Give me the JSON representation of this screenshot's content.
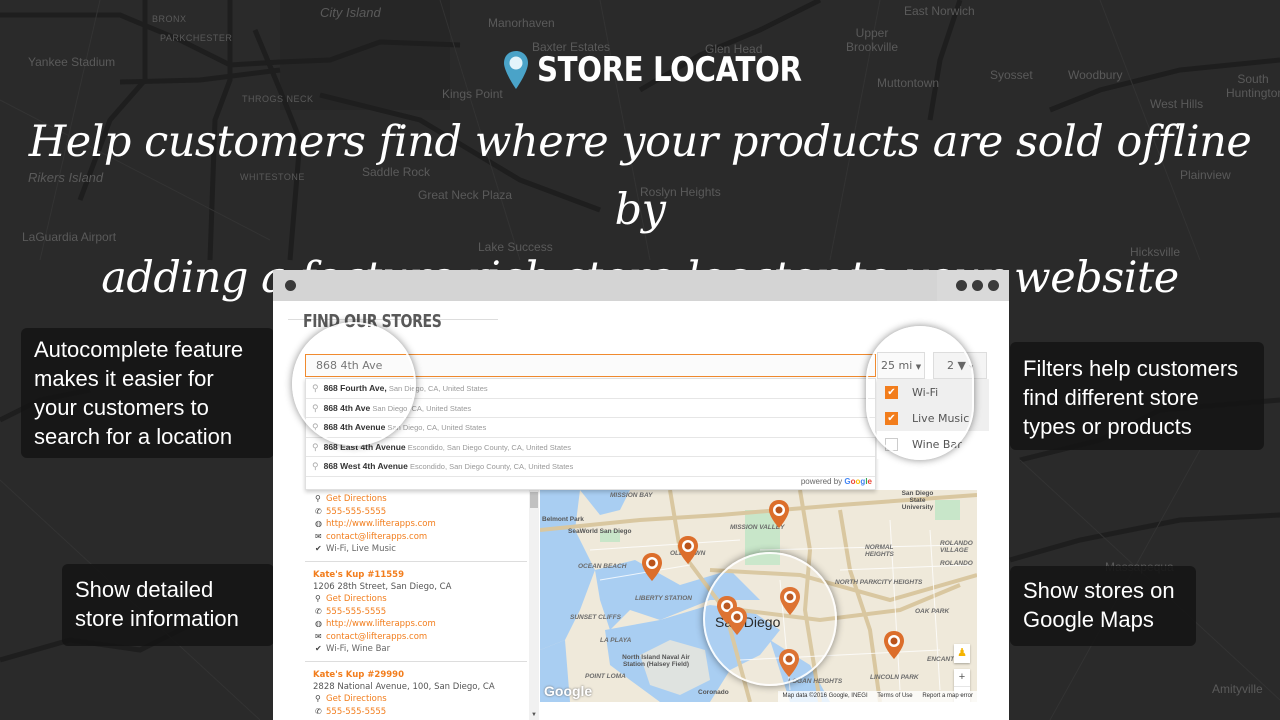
{
  "background_map": {
    "labels": [
      {
        "text": "City Island",
        "style": "it"
      },
      {
        "text": "Yankee Stadium",
        "style": ""
      },
      {
        "text": "Rikers Island",
        "style": "it"
      },
      {
        "text": "LaGuardia Airport",
        "style": ""
      },
      {
        "text": "Kings Point",
        "style": ""
      },
      {
        "text": "Baxter Estates",
        "style": ""
      },
      {
        "text": "Manorhaven",
        "style": ""
      },
      {
        "text": "Glen Head",
        "style": ""
      },
      {
        "text": "East Norwich",
        "style": ""
      },
      {
        "text": "Upper Brookville",
        "style": ""
      },
      {
        "text": "Muttontown",
        "style": ""
      },
      {
        "text": "Syosset",
        "style": ""
      },
      {
        "text": "Woodbury",
        "style": ""
      },
      {
        "text": "South Huntington",
        "style": ""
      },
      {
        "text": "West Hills",
        "style": ""
      },
      {
        "text": "Hicksville",
        "style": ""
      },
      {
        "text": "Plainview",
        "style": ""
      },
      {
        "text": "Lake Success",
        "style": ""
      },
      {
        "text": "Saddle Rock",
        "style": ""
      },
      {
        "text": "Great Neck Plaza",
        "style": ""
      },
      {
        "text": "Roslyn Heights",
        "style": ""
      },
      {
        "text": "BRONX",
        "style": "sm"
      },
      {
        "text": "PARKCHESTER",
        "style": "sm"
      },
      {
        "text": "THROGS NECK",
        "style": "sm"
      },
      {
        "text": "WHITESTONE",
        "style": "sm"
      },
      {
        "text": "Amityville",
        "style": ""
      },
      {
        "text": "Massapequa",
        "style": ""
      }
    ]
  },
  "header": {
    "brand_icon": "map-pin-icon",
    "brand_title": "STORE LOCATOR",
    "tagline_line1": "Help customers find where your products are sold offline by",
    "tagline_line2": "adding a feature rich store locator to your website"
  },
  "callouts": {
    "autocomplete": [
      "Autocomplete feature",
      "makes it easier for",
      "your customers to",
      "search for a location"
    ],
    "filters": [
      "Filters help customers",
      "find different store",
      "types or products"
    ],
    "details": [
      "Show detailed",
      "store information"
    ],
    "maps": [
      "Show stores on",
      "Google Maps"
    ]
  },
  "browser": {
    "menu_icon": "more-dots-icon"
  },
  "widget": {
    "title": "FIND OUR STORES",
    "search_value": "868 4th Ave",
    "radius_value": "25 mi",
    "filter_count": "2",
    "filter_options": [
      {
        "label": "Wi-Fi",
        "checked": true
      },
      {
        "label": "Live Music",
        "checked": true
      },
      {
        "label": "Wine Bar",
        "checked": false
      }
    ],
    "autocomplete": [
      {
        "main": "868 Fourth Ave,",
        "secondary": "San Diego, CA, United States"
      },
      {
        "main": "868 4th Ave",
        "secondary": "San Diego, CA, United States"
      },
      {
        "main": "868 4th Avenue",
        "secondary": "San Diego, CA, United States"
      },
      {
        "main": "868 East 4th Avenue",
        "secondary": "Escondido, San Diego County, CA, United States"
      },
      {
        "main": "868 West 4th Avenue",
        "secondary": "Escondido, San Diego County, CA, United States"
      }
    ],
    "powered_by": "powered by",
    "google_letters": [
      "G",
      "o",
      "o",
      "g",
      "l",
      "e"
    ],
    "stores": [
      {
        "name": "",
        "address": "",
        "directions": "Get Directions",
        "phone": "555-555-5555",
        "website": "http://www.lifterapps.com",
        "email": "contact@lifterapps.com",
        "tags": "Wi-Fi, Live Music"
      },
      {
        "name": "Kate's Kup #11559",
        "address": "1206 28th Street, San Diego, CA",
        "directions": "Get Directions",
        "phone": "555-555-5555",
        "website": "http://www.lifterapps.com",
        "email": "contact@lifterapps.com",
        "tags": "Wi-Fi, Wine Bar"
      },
      {
        "name": "Kate's Kup #29990",
        "address": "2828 National Avenue, 100, San Diego, CA",
        "directions": "Get Directions",
        "phone": "555-555-5555",
        "website": "",
        "email": "",
        "tags": ""
      }
    ],
    "map": {
      "labels": [
        {
          "text": "MISSION BAY",
          "style": "it"
        },
        {
          "text": "Belmont Park",
          "style": ""
        },
        {
          "text": "SeaWorld San Diego",
          "style": ""
        },
        {
          "text": "MISSION VALLEY",
          "style": "it"
        },
        {
          "text": "OLD TOWN",
          "style": "it"
        },
        {
          "text": "OCEAN BEACH",
          "style": "it"
        },
        {
          "text": "LIBERTY STATION",
          "style": "it"
        },
        {
          "text": "SUNSET CLIFFS",
          "style": "it"
        },
        {
          "text": "LA PLAYA",
          "style": "it"
        },
        {
          "text": "North Island Naval Air Station (Halsey Field)",
          "style": ""
        },
        {
          "text": "POINT LOMA",
          "style": "it"
        },
        {
          "text": "Coronado",
          "style": ""
        },
        {
          "text": "San Diego",
          "style": "big"
        },
        {
          "text": "San Diego State University",
          "style": ""
        },
        {
          "text": "NORMAL HEIGHTS",
          "style": "it"
        },
        {
          "text": "NORTH PARK",
          "style": "it"
        },
        {
          "text": "CITY HEIGHTS",
          "style": "it"
        },
        {
          "text": "ROLANDO VILLAGE",
          "style": "it"
        },
        {
          "text": "ROLANDO",
          "style": "it"
        },
        {
          "text": "OAK PARK",
          "style": "it"
        },
        {
          "text": "ENCANTO",
          "style": "it"
        },
        {
          "text": "LINCOLN PARK",
          "style": "it"
        },
        {
          "text": "LOGAN HEIGHTS",
          "style": "it"
        }
      ],
      "google_logo": "Google",
      "footer": [
        "Map data ©2016 Google, INEGI",
        "Terms of Use",
        "Report a map error"
      ],
      "zoom_in": "+",
      "zoom_out": "−"
    }
  },
  "colors": {
    "accent": "#f27d1c",
    "pin": "#dc6e2b",
    "brand_pin": "#4aa3c8",
    "callout_bg": "#141414"
  }
}
